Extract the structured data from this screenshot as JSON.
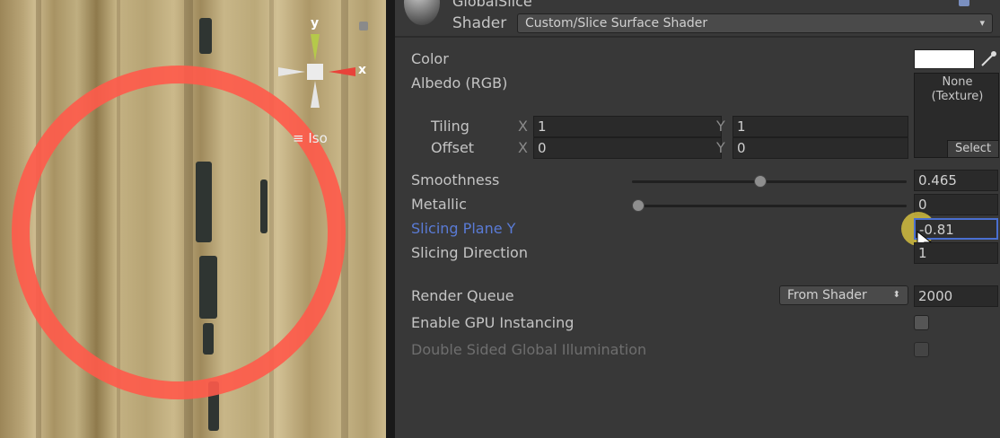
{
  "scene": {
    "axis_y": "y",
    "axis_x": "x",
    "projection": "Iso",
    "colors": {
      "ring": "#ff5a4a",
      "axis_x": "#e8433a",
      "axis_y": "#b5c94a"
    }
  },
  "header": {
    "material_name": "GlobalSlice",
    "shader_label": "Shader",
    "shader_value": "Custom/Slice Surface Shader"
  },
  "props": {
    "color_label": "Color",
    "albedo_label": "Albedo (RGB)",
    "texture_none": "None",
    "texture_kind": "(Texture)",
    "texture_select": "Select",
    "tiling_label": "Tiling",
    "offset_label": "Offset",
    "x_label": "X",
    "y_label": "Y",
    "tiling_x": "1",
    "tiling_y": "1",
    "offset_x": "0",
    "offset_y": "0",
    "smoothness_label": "Smoothness",
    "smoothness_value": "0.465",
    "smoothness_fraction": 0.465,
    "metallic_label": "Metallic",
    "metallic_value": "0",
    "metallic_fraction": 0,
    "slicing_plane_label": "Slicing Plane Y",
    "slicing_plane_value": "-0.81",
    "slicing_direction_label": "Slicing Direction",
    "slicing_direction_value": "1"
  },
  "advanced": {
    "render_queue_label": "Render Queue",
    "render_queue_source": "From Shader",
    "render_queue_value": "2000",
    "gpu_instancing_label": "Enable GPU Instancing",
    "double_sided_gi_label": "Double Sided Global Illumination"
  },
  "colors": {
    "highlight_label": "#5a7bd6",
    "cursor_highlight": "#e8d040"
  }
}
